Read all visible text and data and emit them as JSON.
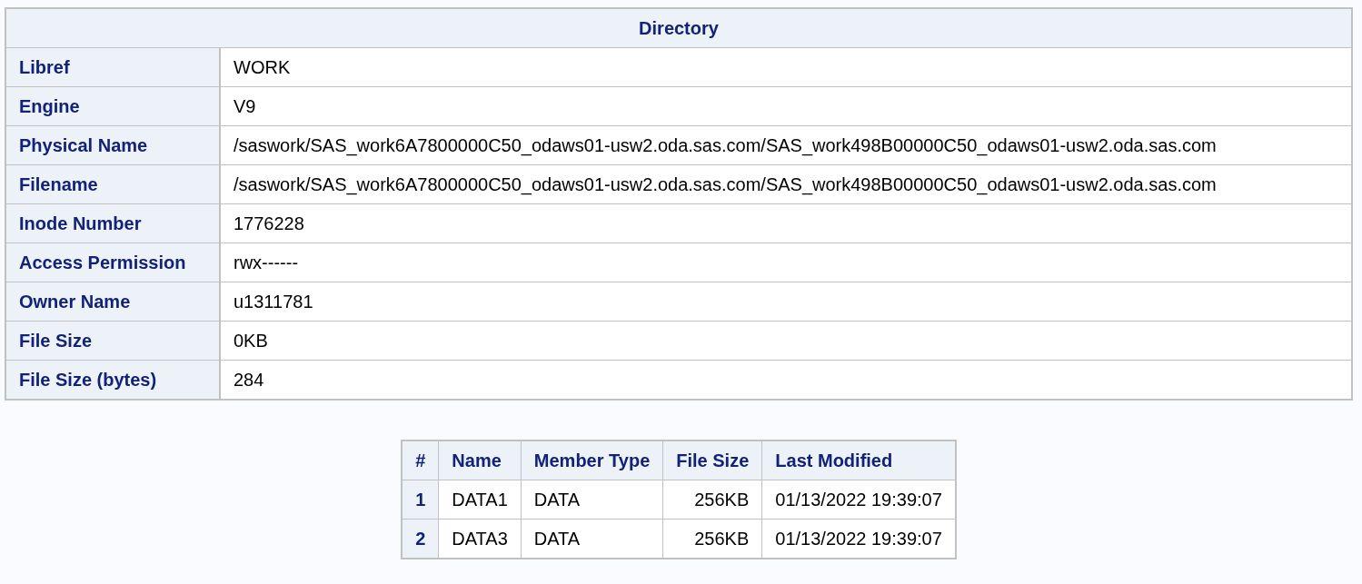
{
  "directory": {
    "title": "Directory",
    "rows": [
      {
        "label": "Libref",
        "value": "WORK"
      },
      {
        "label": "Engine",
        "value": "V9"
      },
      {
        "label": "Physical Name",
        "value": "/saswork/SAS_work6A7800000C50_odaws01-usw2.oda.sas.com/SAS_work498B00000C50_odaws01-usw2.oda.sas.com"
      },
      {
        "label": "Filename",
        "value": "/saswork/SAS_work6A7800000C50_odaws01-usw2.oda.sas.com/SAS_work498B00000C50_odaws01-usw2.oda.sas.com"
      },
      {
        "label": "Inode Number",
        "value": "1776228"
      },
      {
        "label": "Access Permission",
        "value": "rwx------"
      },
      {
        "label": "Owner Name",
        "value": "u1311781"
      },
      {
        "label": "File Size",
        "value": "0KB"
      },
      {
        "label": "File Size (bytes)",
        "value": "284"
      }
    ]
  },
  "members": {
    "columns": [
      {
        "label": "#",
        "kind": "rowheader"
      },
      {
        "label": "Name",
        "kind": "text"
      },
      {
        "label": "Member Type",
        "kind": "text"
      },
      {
        "label": "File Size",
        "kind": "number"
      },
      {
        "label": "Last Modified",
        "kind": "text"
      }
    ],
    "rows": [
      [
        "1",
        "DATA1",
        "DATA",
        "256KB",
        "01/13/2022 19:39:07"
      ],
      [
        "2",
        "DATA3",
        "DATA",
        "256KB",
        "01/13/2022 19:39:07"
      ]
    ]
  }
}
